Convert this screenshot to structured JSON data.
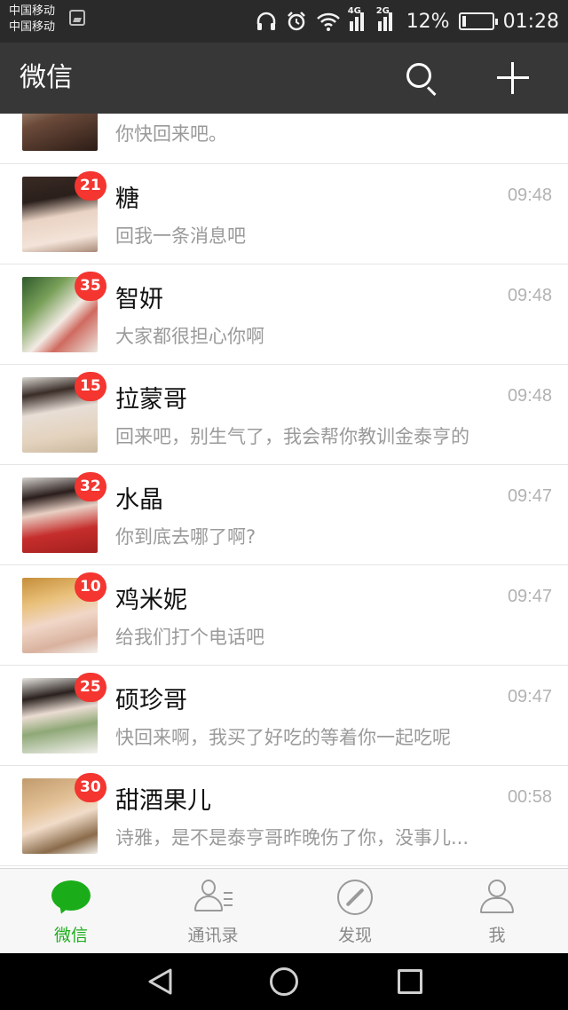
{
  "status_bar": {
    "carrier_1": "中国移动",
    "carrier_2": "中国移动",
    "network_1": "4G",
    "network_2": "2G",
    "battery": "12%",
    "battery_level": 0.12,
    "time": "01:28",
    "icons": [
      "photo-icon",
      "headphones-icon",
      "alarm-icon",
      "wifi-icon",
      "signal-icon",
      "battery-icon"
    ]
  },
  "header": {
    "title": "微信",
    "actions": [
      "search-icon",
      "add-icon"
    ]
  },
  "chats": {
    "partial": {
      "preview": "你快回来吧。"
    },
    "items": [
      {
        "name": "糖",
        "badge": "21",
        "time": "09:48",
        "preview": "回我一条消息吧"
      },
      {
        "name": "智妍",
        "badge": "35",
        "time": "09:48",
        "preview": "大家都很担心你啊"
      },
      {
        "name": "拉蒙哥",
        "badge": "15",
        "time": "09:48",
        "preview": "回来吧，别生气了，我会帮你教训金泰亨的"
      },
      {
        "name": "水晶",
        "badge": "32",
        "time": "09:47",
        "preview": "你到底去哪了啊?"
      },
      {
        "name": "鸡米妮",
        "badge": "10",
        "time": "09:47",
        "preview": "给我们打个电话吧"
      },
      {
        "name": "硕珍哥",
        "badge": "25",
        "time": "09:47",
        "preview": "快回来啊，我买了好吃的等着你一起吃呢"
      },
      {
        "name": "甜酒果儿",
        "badge": "30",
        "time": "00:58",
        "preview": "诗雅，是不是泰亨哥昨晚伤了你，没事儿..."
      }
    ]
  },
  "tabbar": {
    "tabs": [
      {
        "label": "微信",
        "icon": "chat-bubble-icon",
        "active": true,
        "color": "#1aad19"
      },
      {
        "label": "通讯录",
        "icon": "contacts-icon",
        "active": false
      },
      {
        "label": "发现",
        "icon": "compass-icon",
        "active": false
      },
      {
        "label": "我",
        "icon": "person-icon",
        "active": false
      }
    ]
  },
  "nav_bar": {
    "buttons": [
      "back-icon",
      "home-icon",
      "recent-apps-icon"
    ]
  },
  "colors": {
    "header_bg": "#373737",
    "status_bg": "#2a2a2a",
    "badge": "#f43530",
    "accent": "#1aad19"
  }
}
